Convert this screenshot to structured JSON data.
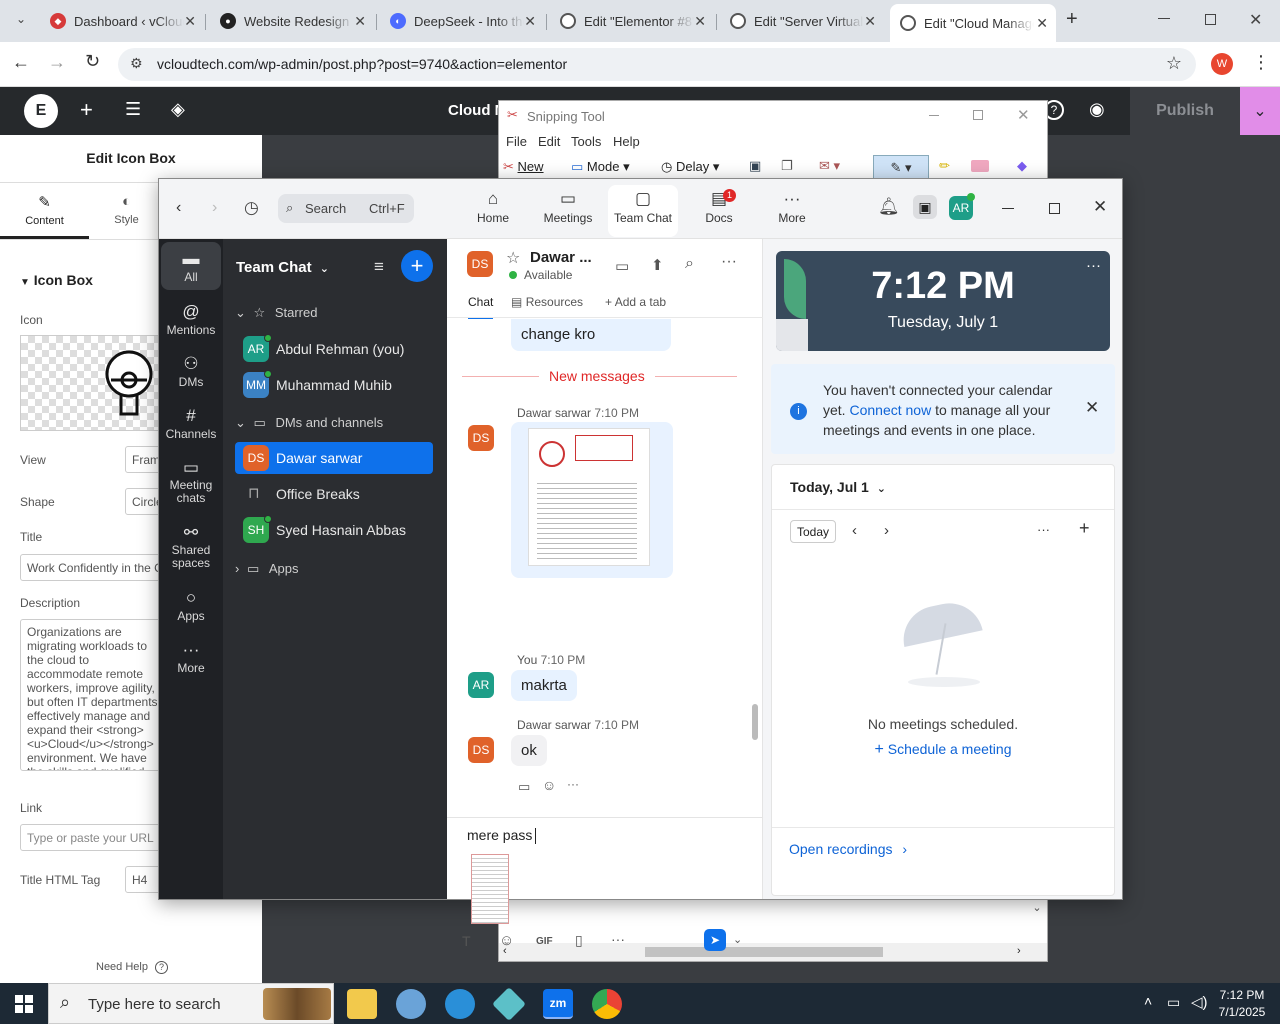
{
  "browser": {
    "tabs": [
      {
        "title": "Dashboard ‹ vCloudTech",
        "color": "#d63a3a"
      },
      {
        "title": "Website Redesign",
        "color": "#222"
      },
      {
        "title": "DeepSeek - Into the Unknown",
        "color": "#4d6bfe"
      },
      {
        "title": "Edit \"Elementor #8\"",
        "color": "#555"
      },
      {
        "title": "Edit \"Server Virtualization\"",
        "color": "#555"
      },
      {
        "title": "Edit \"Cloud Management\"",
        "color": "#555"
      }
    ],
    "new_tab": "+",
    "url": "vcloudtech.com/wp-admin/post.php?post=9740&action=elementor",
    "profile_letter": "W"
  },
  "elementor": {
    "page_title": "Cloud M",
    "publish": "Publish",
    "panel_title": "Edit Icon Box",
    "tabs": {
      "content": "Content",
      "style": "Style"
    },
    "section": "Icon Box",
    "icon_label": "Icon",
    "view_label": "View",
    "view_value": "Framed",
    "shape_label": "Shape",
    "shape_value": "Circle",
    "title_label": "Title",
    "title_value": "Work Confidently in the Cloud",
    "description_label": "Description",
    "description_value": "Organizations are migrating workloads to the cloud to accommodate remote workers, improve agility, but often IT departments effectively manage and expand their <strong><u>Cloud</u></strong> environment. We have the skills and qualified subject matter experts to help you protect, and grow your cloud environment, providing",
    "link_label": "Link",
    "link_placeholder": "Type or paste your URL",
    "html_tag_label": "Title HTML Tag",
    "html_tag_value": "H4",
    "need_help": "Need Help"
  },
  "snipping": {
    "title": "Snipping Tool",
    "menu": [
      "File",
      "Edit",
      "Tools",
      "Help"
    ],
    "new": "New",
    "mode": "Mode",
    "delay": "Delay"
  },
  "zoom": {
    "search_placeholder": "Search",
    "search_shortcut": "Ctrl+F",
    "nav": [
      {
        "label": "Home",
        "icon": "⌂"
      },
      {
        "label": "Meetings",
        "icon": "▭"
      },
      {
        "label": "Team Chat",
        "icon": "▢"
      },
      {
        "label": "Docs",
        "icon": "▤",
        "badge": "1"
      },
      {
        "label": "More",
        "icon": "···"
      }
    ],
    "user_initials": "AR",
    "rail": [
      {
        "label": "All",
        "icon": "▬"
      },
      {
        "label": "Mentions",
        "icon": "@"
      },
      {
        "label": "DMs",
        "icon": "⚇"
      },
      {
        "label": "Channels",
        "icon": "#"
      },
      {
        "label": "Meeting chats",
        "icon": "▭"
      },
      {
        "label": "Shared spaces",
        "icon": "⚯"
      },
      {
        "label": "Apps",
        "icon": "○"
      },
      {
        "label": "More",
        "icon": "···"
      }
    ],
    "list": {
      "header": "Team Chat",
      "starred": "Starred",
      "starred_items": [
        {
          "initials": "AR",
          "name": "Abdul Rehman (you)",
          "color": "#1e9e88"
        },
        {
          "initials": "MM",
          "name": "Muhammad Muhib",
          "color": "#3b82c4"
        }
      ],
      "dms": "DMs and channels",
      "dm_items": [
        {
          "initials": "DS",
          "name": "Dawar sarwar",
          "color": "#e0622a"
        },
        {
          "initials": "",
          "name": "Office Breaks",
          "color": ""
        },
        {
          "initials": "SH",
          "name": "Syed Hasnain Abbas",
          "color": "#2fa84f"
        }
      ],
      "apps": "Apps"
    },
    "chat": {
      "contact_initials": "DS",
      "contact_name": "Dawar ...",
      "status": "Available",
      "tabs": [
        "Chat",
        "Resources",
        "Add a tab"
      ],
      "prev_message": "change kro",
      "new_messages": "New messages",
      "messages": [
        {
          "initials": "DS",
          "sender": "Dawar sarwar",
          "time": "7:10 PM",
          "text": ""
        },
        {
          "initials": "AR",
          "sender": "You",
          "time": "7:10 PM",
          "text": "makrta"
        },
        {
          "initials": "DS",
          "sender": "Dawar sarwar",
          "time": "7:10 PM",
          "text": "ok"
        }
      ],
      "compose_text": "mere pass",
      "gif": "GIF"
    },
    "right": {
      "time": "7:12 PM",
      "date": "Tuesday, July 1",
      "calendar_pre": "You haven't connected your calendar yet.",
      "calendar_link": "Connect now",
      "calendar_post": "to manage all your meetings and events in one place.",
      "today_header": "Today, Jul 1",
      "today_btn": "Today",
      "no_meetings": "No meetings scheduled.",
      "schedule": "Schedule a meeting",
      "open_recordings": "Open recordings"
    }
  },
  "taskbar": {
    "search_placeholder": "Type here to search",
    "time": "7:12 PM",
    "date": "7/1/2025"
  }
}
